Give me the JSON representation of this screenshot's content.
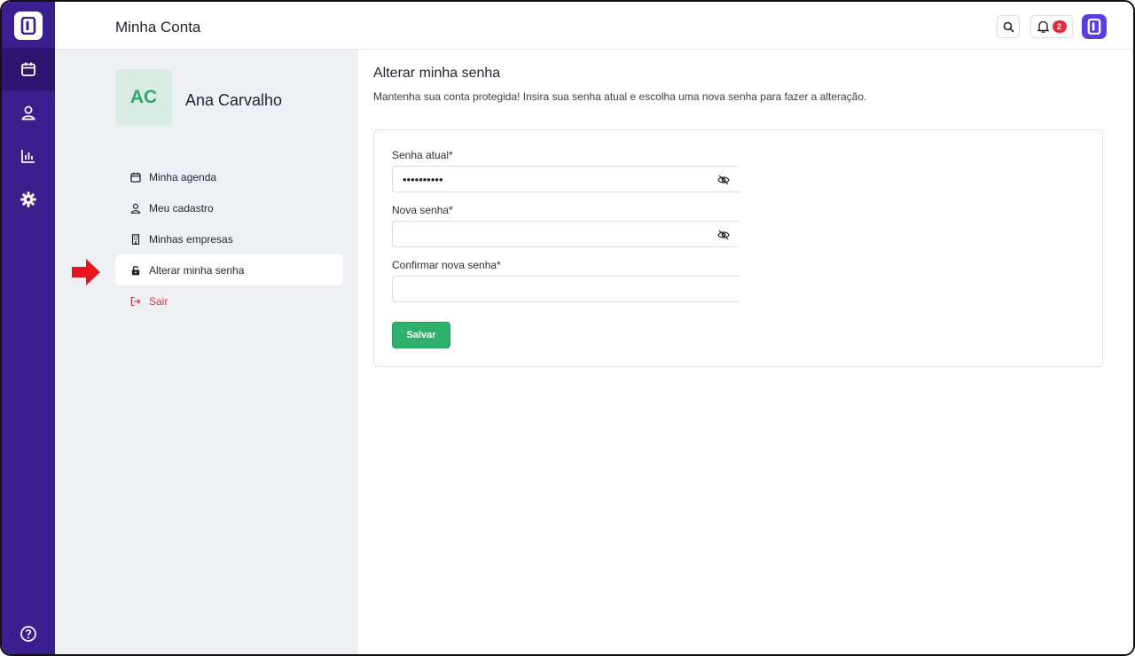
{
  "header": {
    "title": "Minha Conta",
    "notifications_count": "2"
  },
  "rail": {
    "items": [
      {
        "icon": "calendar-icon",
        "active": true
      },
      {
        "icon": "user-icon",
        "active": false
      },
      {
        "icon": "chart-icon",
        "active": false
      },
      {
        "icon": "gear-icon",
        "active": false
      }
    ],
    "help_icon": "help-icon"
  },
  "profile": {
    "initials": "AC",
    "name": "Ana Carvalho"
  },
  "menu": {
    "items": [
      {
        "label": "Minha agenda",
        "icon": "calendar-icon"
      },
      {
        "label": "Meu cadastro",
        "icon": "user-icon"
      },
      {
        "label": "Minhas empresas",
        "icon": "building-icon"
      },
      {
        "label": "Alterar minha senha",
        "icon": "lock-icon",
        "active": true
      },
      {
        "label": "Sair",
        "icon": "logout-icon"
      }
    ]
  },
  "section": {
    "title": "Alterar minha senha",
    "description": "Mantenha sua conta protegida! Insira sua senha atual e escolha uma nova senha para fazer a alteração."
  },
  "form": {
    "current_password": {
      "label": "Senha atual*",
      "value": "••••••••••"
    },
    "new_password": {
      "label": "Nova senha*",
      "value": ""
    },
    "confirm_password": {
      "label": "Confirmar nova senha*",
      "value": ""
    },
    "save_label": "Salvar"
  },
  "colors": {
    "rail": "#3a1f8f",
    "accent": "#5b3ee0",
    "success": "#2eb06d",
    "danger": "#d9363e",
    "pointer": "#e8141e"
  }
}
